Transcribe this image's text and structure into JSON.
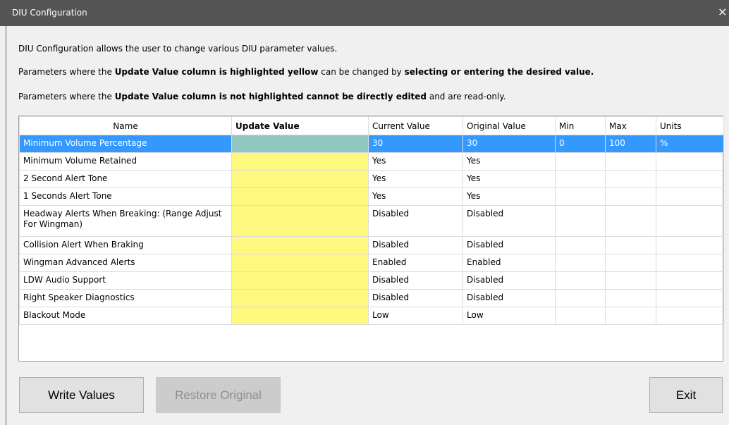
{
  "window": {
    "title": "DIU Configuration",
    "close_glyph": "×"
  },
  "description": {
    "line1": "DIU Configuration allows the user to change various DIU parameter values.",
    "line2": {
      "a": "Parameters where the ",
      "b": "Update Value column is highlighted yellow",
      "c": " can be changed by ",
      "d": "selecting or entering the desired value."
    },
    "line3": {
      "a": "Parameters where the ",
      "b": "Update Value column is not highlighted cannot be directly edited",
      "c": " and are read-only."
    }
  },
  "table": {
    "headers": {
      "name": "Name",
      "update": "Update Value",
      "current": "Current Value",
      "original": "Original Value",
      "min": "Min",
      "max": "Max",
      "units": "Units"
    },
    "rows": [
      {
        "name": "Minimum Volume Percentage",
        "update": "",
        "current": "30",
        "original": "30",
        "min": "0",
        "max": "100",
        "units": "%",
        "selected": true
      },
      {
        "name": "Minimum Volume Retained",
        "update": "",
        "current": "Yes",
        "original": "Yes",
        "min": "",
        "max": "",
        "units": ""
      },
      {
        "name": "2 Second Alert Tone",
        "update": "",
        "current": "Yes",
        "original": "Yes",
        "min": "",
        "max": "",
        "units": ""
      },
      {
        "name": "1 Seconds Alert Tone",
        "update": "",
        "current": "Yes",
        "original": "Yes",
        "min": "",
        "max": "",
        "units": ""
      },
      {
        "name": "Headway Alerts When Breaking: (Range Adjust For Wingman)",
        "update": "",
        "current": "Disabled",
        "original": "Disabled",
        "min": "",
        "max": "",
        "units": "",
        "tall": true
      },
      {
        "name": "Collision Alert When Braking",
        "update": "",
        "current": "Disabled",
        "original": "Disabled",
        "min": "",
        "max": "",
        "units": ""
      },
      {
        "name": "Wingman Advanced Alerts",
        "update": "",
        "current": "Enabled",
        "original": "Enabled",
        "min": "",
        "max": "",
        "units": ""
      },
      {
        "name": "LDW Audio Support",
        "update": "",
        "current": "Disabled",
        "original": "Disabled",
        "min": "",
        "max": "",
        "units": ""
      },
      {
        "name": "Right Speaker Diagnostics",
        "update": "",
        "current": "Disabled",
        "original": "Disabled",
        "min": "",
        "max": "",
        "units": ""
      },
      {
        "name": "Blackout Mode",
        "update": "",
        "current": "Low",
        "original": "Low",
        "min": "",
        "max": "",
        "units": ""
      }
    ]
  },
  "buttons": {
    "write": "Write Values",
    "restore": "Restore Original",
    "exit": "Exit"
  }
}
